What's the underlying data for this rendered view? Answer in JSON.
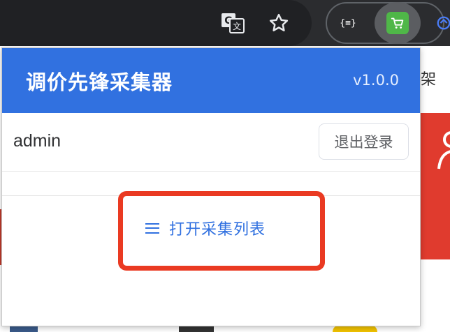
{
  "browser": {
    "toolbar_buttons": [
      {
        "name": "translate",
        "icon": "translate-icon"
      },
      {
        "name": "bookmark",
        "icon": "star-icon"
      },
      {
        "name": "json-extension",
        "label": "{≡}"
      },
      {
        "name": "cart-extension",
        "icon": "cart-icon"
      }
    ]
  },
  "page": {
    "nav_text_fragment": "架"
  },
  "popup": {
    "title": "调价先锋采集器",
    "version": "v1.0.0",
    "username": "admin",
    "logout_label": "退出登录",
    "open_list_label": "打开采集列表",
    "colors": {
      "header": "#3171e0",
      "link": "#3171e0",
      "highlight": "#ea3a22"
    }
  }
}
